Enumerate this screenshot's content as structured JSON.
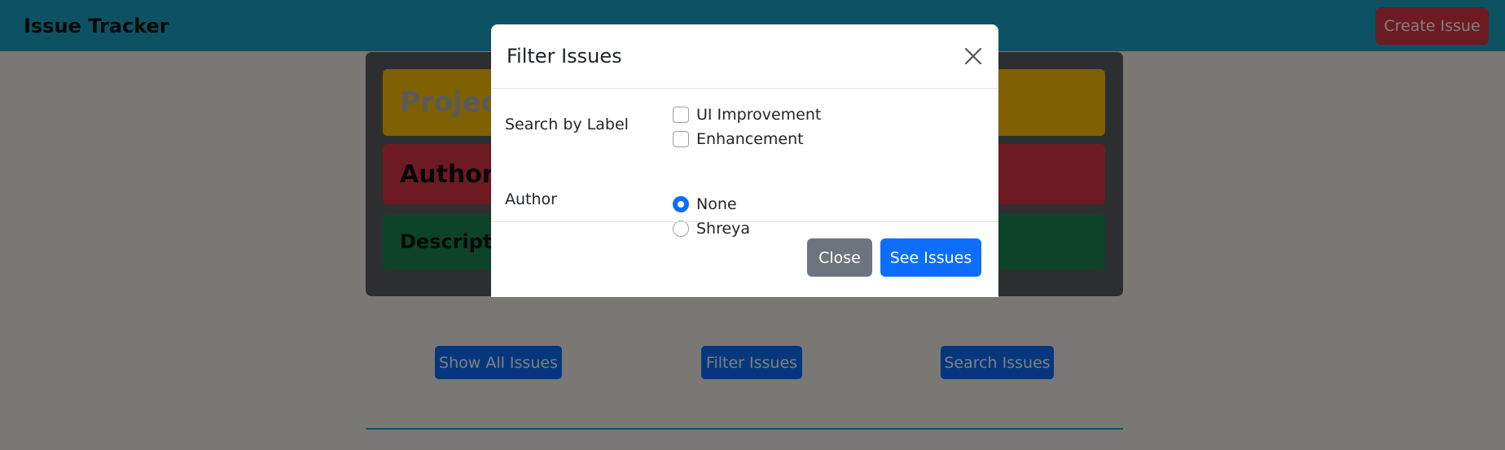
{
  "navbar": {
    "brand": "Issue Tracker",
    "create_button": "Create Issue"
  },
  "issue_card": {
    "project_prefix": "Project",
    "author_prefix": "Author :",
    "description_prefix": "Descriptio"
  },
  "actions": {
    "show_all": "Show All Issues",
    "filter": "Filter Issues",
    "search": "Search Issues"
  },
  "modal": {
    "title": "Filter Issues",
    "label_search": "Search by Label",
    "labels": [
      {
        "text": "UI Improvement",
        "checked": false
      },
      {
        "text": "Enhancement",
        "checked": false
      }
    ],
    "label_author": "Author",
    "authors": [
      {
        "text": "None",
        "checked": true
      },
      {
        "text": "Shreya",
        "checked": false
      }
    ],
    "close_button": "Close",
    "see_button": "See Issues"
  },
  "colors": {
    "navbar": "#1aa5c5",
    "primary": "#0d6efd",
    "danger": "#dc3545",
    "warning": "#ffc107",
    "success": "#198754",
    "secondary": "#6c757d"
  }
}
